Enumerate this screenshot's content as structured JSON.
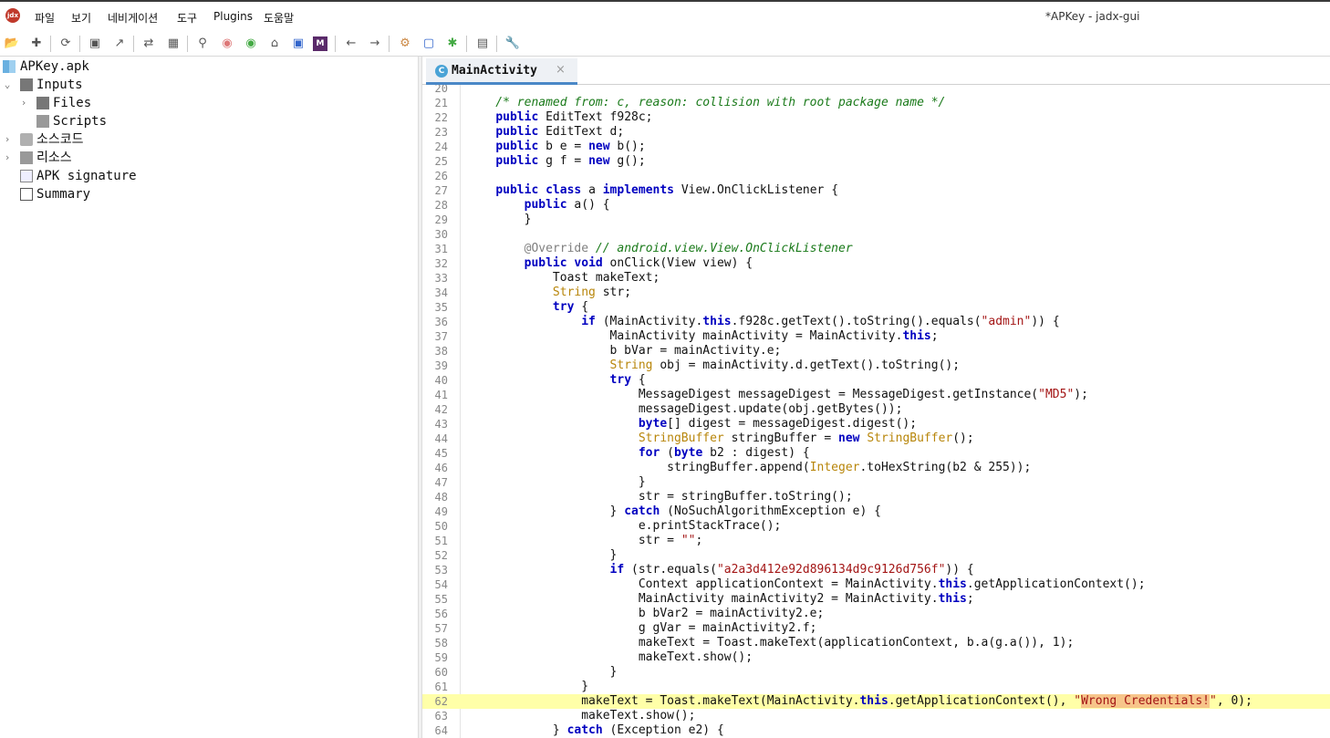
{
  "app": {
    "logo_text": "jdx",
    "window_title": "*APKey - jadx-gui"
  },
  "menu": [
    "파일",
    "보기",
    "네비게이션",
    "도구",
    "Plugins",
    "도움말"
  ],
  "toolbar": {
    "icons": [
      "open-file-icon",
      "add-files-icon",
      "reload-icon",
      "save-icon",
      "export-icon",
      "sync-editor-icon",
      "flatten-packages-icon",
      "search-icon",
      "find-usage-icon",
      "find-class-icon",
      "home-icon",
      "log-viewer-icon",
      "decompile-mode-icon",
      "back-icon",
      "forward-icon",
      "quark-icon",
      "deobfuscation-icon",
      "debug-icon",
      "log-icon",
      "preferences-icon"
    ]
  },
  "tree": {
    "root": "APKey.apk",
    "inputs": "Inputs",
    "files": "Files",
    "scripts": "Scripts",
    "source_code": "소스코드",
    "resources": "리소스",
    "apk_signature": "APK signature",
    "summary": "Summary"
  },
  "editor": {
    "tab_label": "MainActivity",
    "tab_icon_letter": "C",
    "tab_close": "×",
    "highlighted_line": 62,
    "lines": [
      {
        "n": "20",
        "t": ""
      },
      {
        "n": "21",
        "t": "    /* renamed from: c, reason: collision with root package name */"
      },
      {
        "n": "22",
        "t": "    public EditText f928c;"
      },
      {
        "n": "23",
        "t": "    public EditText d;"
      },
      {
        "n": "24",
        "t": "    public b e = new b();"
      },
      {
        "n": "25",
        "t": "    public g f = new g();"
      },
      {
        "n": "26",
        "t": ""
      },
      {
        "n": "27",
        "t": "    public class a implements View.OnClickListener {"
      },
      {
        "n": "28",
        "t": "        public a() {"
      },
      {
        "n": "29",
        "t": "        }"
      },
      {
        "n": "30",
        "t": ""
      },
      {
        "n": "31",
        "t": "        @Override // android.view.View.OnClickListener"
      },
      {
        "n": "32",
        "t": "        public void onClick(View view) {"
      },
      {
        "n": "33",
        "t": "            Toast makeText;"
      },
      {
        "n": "34",
        "t": "            String str;"
      },
      {
        "n": "35",
        "t": "            try {"
      },
      {
        "n": "36",
        "t": "                if (MainActivity.this.f928c.getText().toString().equals(\"admin\")) {"
      },
      {
        "n": "37",
        "t": "                    MainActivity mainActivity = MainActivity.this;"
      },
      {
        "n": "38",
        "t": "                    b bVar = mainActivity.e;"
      },
      {
        "n": "39",
        "t": "                    String obj = mainActivity.d.getText().toString();"
      },
      {
        "n": "40",
        "t": "                    try {"
      },
      {
        "n": "41",
        "t": "                        MessageDigest messageDigest = MessageDigest.getInstance(\"MD5\");"
      },
      {
        "n": "42",
        "t": "                        messageDigest.update(obj.getBytes());"
      },
      {
        "n": "43",
        "t": "                        byte[] digest = messageDigest.digest();"
      },
      {
        "n": "44",
        "t": "                        StringBuffer stringBuffer = new StringBuffer();"
      },
      {
        "n": "45",
        "t": "                        for (byte b2 : digest) {"
      },
      {
        "n": "46",
        "t": "                            stringBuffer.append(Integer.toHexString(b2 & 255));"
      },
      {
        "n": "47",
        "t": "                        }"
      },
      {
        "n": "48",
        "t": "                        str = stringBuffer.toString();"
      },
      {
        "n": "49",
        "t": "                    } catch (NoSuchAlgorithmException e) {"
      },
      {
        "n": "50",
        "t": "                        e.printStackTrace();"
      },
      {
        "n": "51",
        "t": "                        str = \"\";"
      },
      {
        "n": "52",
        "t": "                    }"
      },
      {
        "n": "53",
        "t": "                    if (str.equals(\"a2a3d412e92d896134d9c9126d756f\")) {"
      },
      {
        "n": "54",
        "t": "                        Context applicationContext = MainActivity.this.getApplicationContext();"
      },
      {
        "n": "55",
        "t": "                        MainActivity mainActivity2 = MainActivity.this;"
      },
      {
        "n": "56",
        "t": "                        b bVar2 = mainActivity2.e;"
      },
      {
        "n": "57",
        "t": "                        g gVar = mainActivity2.f;"
      },
      {
        "n": "58",
        "t": "                        makeText = Toast.makeText(applicationContext, b.a(g.a()), 1);"
      },
      {
        "n": "59",
        "t": "                        makeText.show();"
      },
      {
        "n": "60",
        "t": "                    }"
      },
      {
        "n": "61",
        "t": "                }"
      },
      {
        "n": "62",
        "t": "                makeText = Toast.makeText(MainActivity.this.getApplicationContext(), \"Wrong Credentials!\", 0);"
      },
      {
        "n": "63",
        "t": "                makeText.show();"
      },
      {
        "n": "64",
        "t": "            } catch (Exception e2) {"
      }
    ]
  }
}
